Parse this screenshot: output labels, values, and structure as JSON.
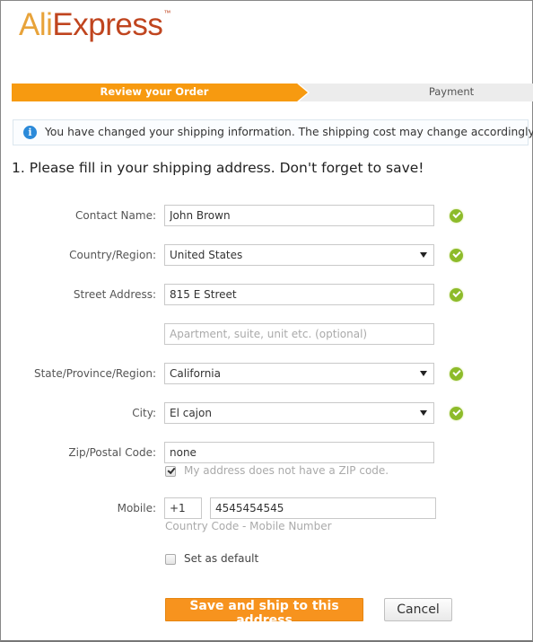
{
  "brand": {
    "logo_part1": "Ali",
    "logo_part2": "Express",
    "trademark": "™"
  },
  "progress": {
    "steps": [
      {
        "label": "Review your Order",
        "active": true
      },
      {
        "label": "Payment",
        "active": false
      }
    ],
    "active_color": "#f79a10"
  },
  "notice": {
    "icon": "info-icon",
    "text": "You have changed your shipping information. The shipping cost may change accordingly."
  },
  "form": {
    "heading": "1. Please fill in your shipping address. Don't forget to save!",
    "contact_name": {
      "label": "Contact Name:",
      "value": "John Brown",
      "valid": true
    },
    "country": {
      "label": "Country/Region:",
      "value": "United States",
      "valid": true
    },
    "street": {
      "label": "Street Address:",
      "value": "815 E Street",
      "valid": true
    },
    "street2": {
      "value": "",
      "placeholder": "Apartment, suite, unit etc. (optional)"
    },
    "state": {
      "label": "State/Province/Region:",
      "value": "California",
      "valid": true
    },
    "city": {
      "label": "City:",
      "value": "El cajon",
      "valid": true
    },
    "zip": {
      "label": "Zip/Postal Code:",
      "value": "none",
      "no_zip_label": "My address does not have a ZIP code.",
      "no_zip_checked": true
    },
    "mobile": {
      "label": "Mobile:",
      "country_code": "+1",
      "number": "4545454545",
      "hint": "Country Code - Mobile Number"
    },
    "set_default": {
      "label": "Set as default",
      "checked": false
    }
  },
  "actions": {
    "save_label": "Save and ship to this address",
    "cancel_label": "Cancel",
    "save_color": "#f7931e"
  }
}
